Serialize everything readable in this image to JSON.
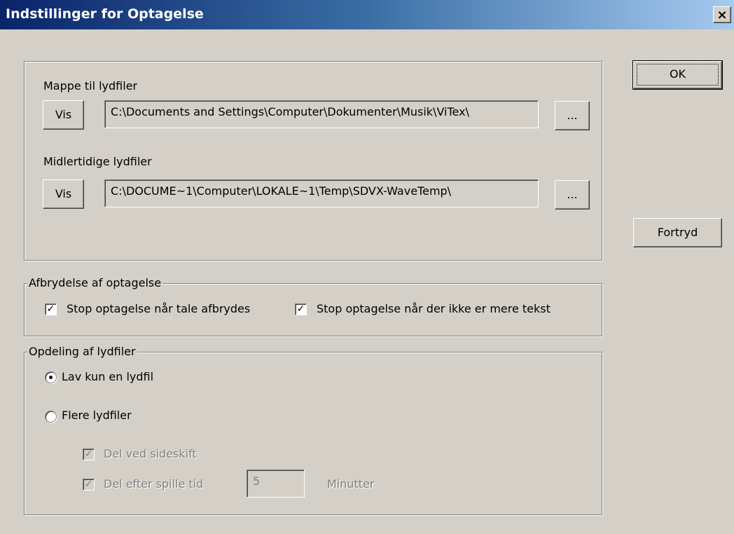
{
  "window": {
    "title": "Indstillinger for Optagelse",
    "close_glyph": "×"
  },
  "buttons": {
    "ok_label": "OK",
    "cancel_label": "Fortryd"
  },
  "folders": {
    "audio_label": "Mappe til lydfiler",
    "audio_show": "Vis",
    "audio_path": "C:\\Documents and Settings\\Computer\\Dokumenter\\Musik\\ViTex\\",
    "audio_browse": "...",
    "temp_label": "Midlertidige lydfiler",
    "temp_show": "Vis",
    "temp_path": "C:\\DOCUME~1\\Computer\\LOKALE~1\\Temp\\SDVX-WaveTemp\\",
    "temp_browse": "..."
  },
  "interrupt": {
    "legend": "Afbrydelse af optagelse",
    "stop_on_speech_label": "Stop optagelse når tale afbrydes",
    "stop_on_speech_checked": true,
    "stop_on_text_label": "Stop optagelse når der ikke er mere tekst",
    "stop_on_text_checked": true
  },
  "split": {
    "legend": "Opdeling af lydfiler",
    "single_label": "Lav kun en lydfil",
    "single_selected": true,
    "multi_label": "Flere lydfiler",
    "multi_selected": false,
    "page_break_label": "Del ved sideskift",
    "page_break_checked": true,
    "duration_label": "Del efter spille tid",
    "duration_checked": true,
    "duration_value": "5",
    "duration_unit": "Minutter"
  },
  "colors": {
    "title_gradient_start": "#0a246a",
    "title_gradient_end": "#a6caf0",
    "face": "#d4d0c8"
  }
}
